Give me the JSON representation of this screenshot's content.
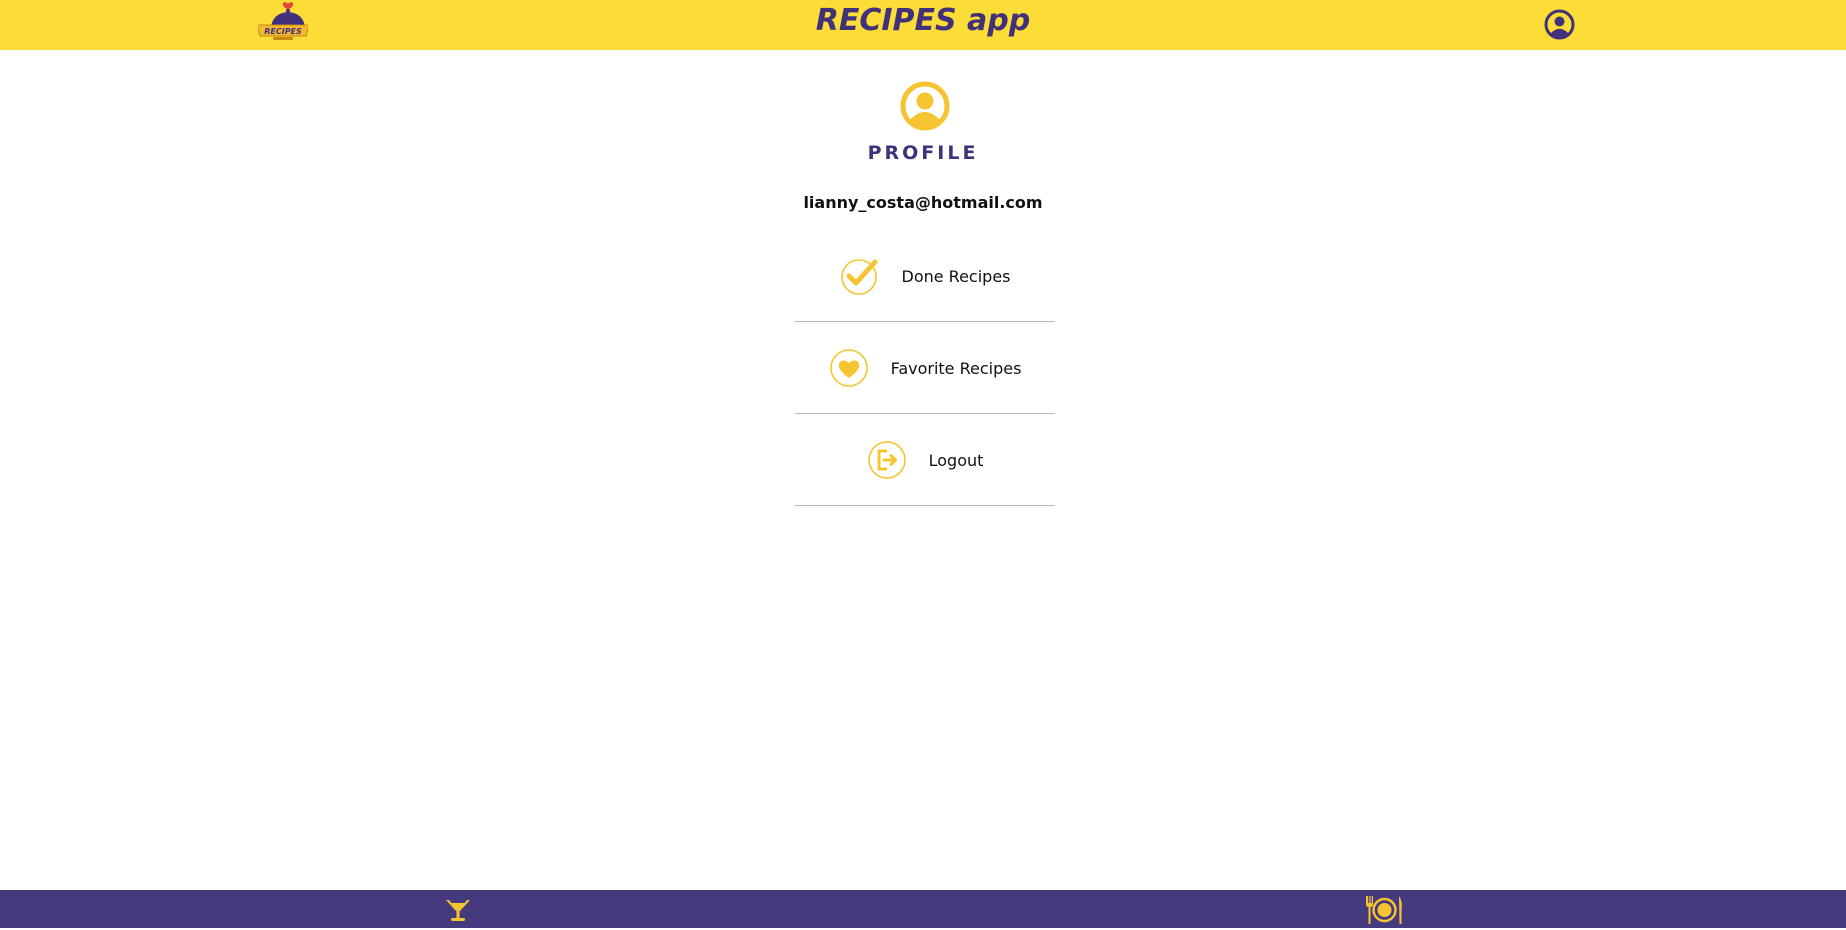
{
  "header": {
    "title": "RECIPES app",
    "logo_text": "RECIPES",
    "profile_icon": "user-circle-icon"
  },
  "main": {
    "hero_icon": "user-circle-icon",
    "heading": "PROFILE",
    "email": "lianny_costa@hotmail.com",
    "menu": [
      {
        "label": "Done Recipes",
        "icon": "check-circle-icon"
      },
      {
        "label": "Favorite Recipes",
        "icon": "heart-circle-icon"
      },
      {
        "label": "Logout",
        "icon": "logout-circle-icon"
      }
    ]
  },
  "footer": {
    "left_icon": "cocktail-icon",
    "right_icon": "plate-cutlery-icon"
  },
  "colors": {
    "header_bg": "#fcdc36",
    "footer_bg": "#463a7e",
    "accent_yellow": "#f6c431",
    "brand_purple": "#41307a"
  }
}
